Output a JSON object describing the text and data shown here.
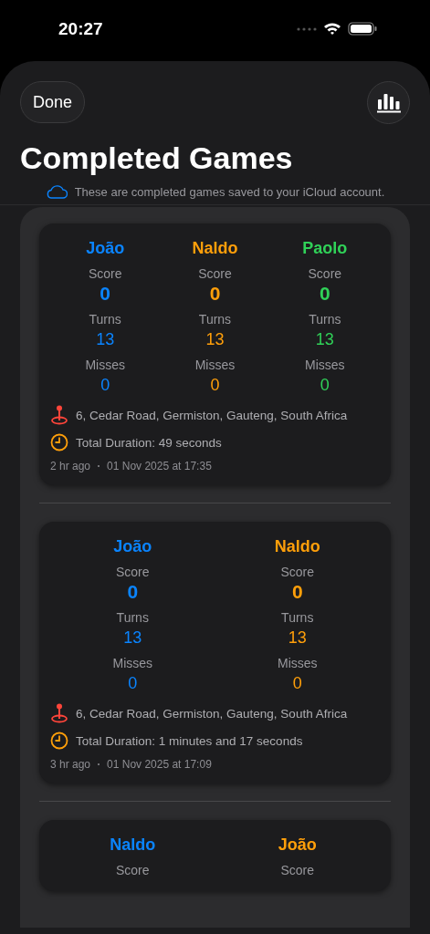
{
  "status_bar": {
    "time": "20:27"
  },
  "nav": {
    "done_button": "Done"
  },
  "title": "Completed Games",
  "icloud_note": "These are completed games saved to your iCloud account.",
  "games": [
    {
      "players": [
        {
          "name": "João",
          "color": "#0a84ff",
          "stats": [
            {
              "label": "Score",
              "value": "0"
            },
            {
              "label": "Turns",
              "value": "13"
            },
            {
              "label": "Misses",
              "value": "0"
            }
          ]
        },
        {
          "name": "Naldo",
          "color": "#ff9f0a",
          "stats": [
            {
              "label": "Score",
              "value": "0"
            },
            {
              "label": "Turns",
              "value": "13"
            },
            {
              "label": "Misses",
              "value": "0"
            }
          ]
        },
        {
          "name": "Paolo",
          "color": "#30d158",
          "stats": [
            {
              "label": "Score",
              "value": "0"
            },
            {
              "label": "Turns",
              "value": "13"
            },
            {
              "label": "Misses",
              "value": "0"
            }
          ]
        }
      ],
      "location": "6, Cedar Road, Germiston, Gauteng, South Africa",
      "duration": "Total Duration: 49 seconds",
      "ago": "2 hr ago",
      "date": "01 Nov 2025 at 17:35"
    },
    {
      "players": [
        {
          "name": "João",
          "color": "#0a84ff",
          "stats": [
            {
              "label": "Score",
              "value": "0"
            },
            {
              "label": "Turns",
              "value": "13"
            },
            {
              "label": "Misses",
              "value": "0"
            }
          ]
        },
        {
          "name": "Naldo",
          "color": "#ff9f0a",
          "stats": [
            {
              "label": "Score",
              "value": "0"
            },
            {
              "label": "Turns",
              "value": "13"
            },
            {
              "label": "Misses",
              "value": "0"
            }
          ]
        }
      ],
      "location": "6, Cedar Road, Germiston, Gauteng, South Africa",
      "duration": "Total Duration: 1 minutes and 17 seconds",
      "ago": "3 hr ago",
      "date": "01 Nov 2025 at 17:09"
    },
    {
      "players": [
        {
          "name": "Naldo",
          "color": "#0a84ff",
          "stats": [
            {
              "label": "Score"
            }
          ]
        },
        {
          "name": "João",
          "color": "#ff9f0a",
          "stats": [
            {
              "label": "Score"
            }
          ]
        }
      ]
    }
  ]
}
